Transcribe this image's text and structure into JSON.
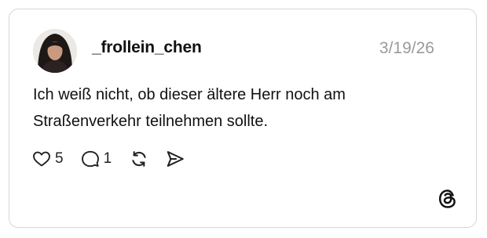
{
  "post": {
    "username": "_frollein_chen",
    "date": "3/19/26",
    "text": "Ich weiß nicht, ob dieser ältere Herr noch am Straßenverkehr teilnehmen sollte.",
    "likes": "5",
    "replies": "1"
  },
  "icons": {
    "like": "heart-icon",
    "reply": "speech-bubble-icon",
    "repost": "repost-icon",
    "share": "send-icon",
    "brand": "threads-logo-icon"
  },
  "colors": {
    "text": "#111111",
    "muted": "#9a9a9a",
    "border": "#d6d6d6"
  }
}
